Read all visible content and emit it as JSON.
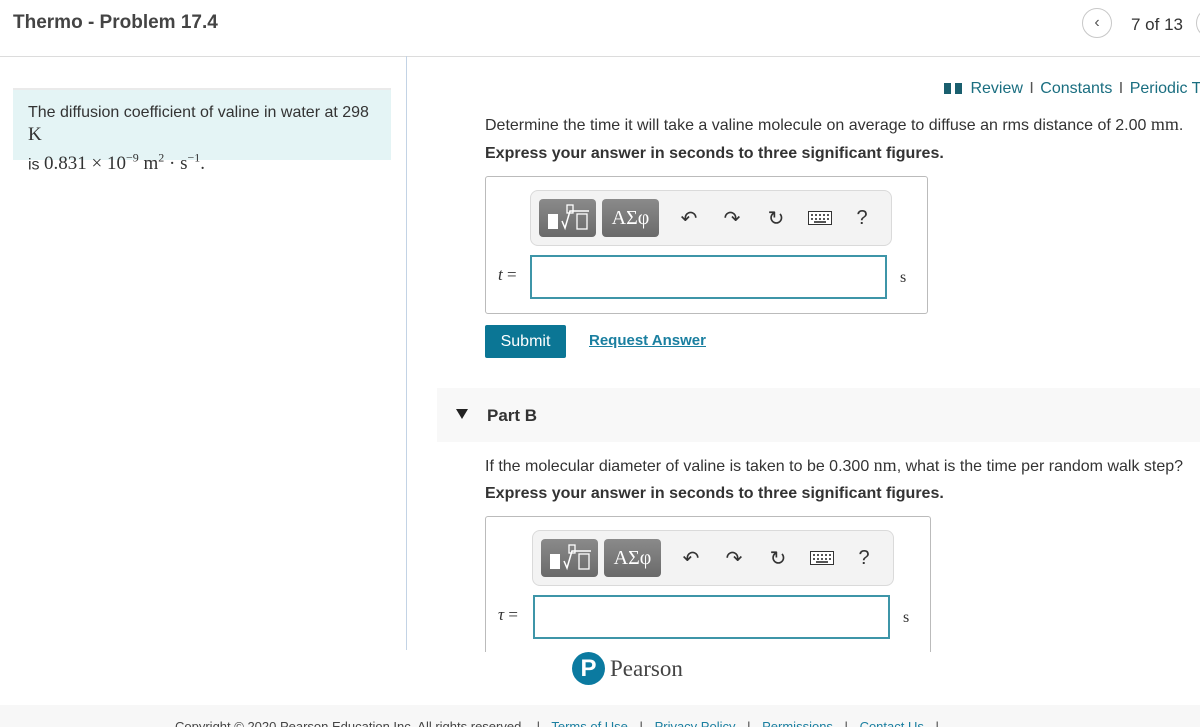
{
  "header": {
    "title": "Thermo - Problem 17.4",
    "nav": {
      "prev_icon": "chevron-left-icon",
      "position": "7 of 13",
      "next_icon": "chevron-right-icon"
    }
  },
  "intro": {
    "text": "The diffusion coefficient of valine in water at 298",
    "temp_unit": "K",
    "line2_prefix": "is ",
    "value": "0.831 × 10",
    "exponent": "−9",
    "unit_m": " m",
    "unit_m_exp": "2",
    "unit_dot_s": " · s",
    "unit_s_exp": "−1",
    "period": "."
  },
  "resources": {
    "icon": "book-icon",
    "links": [
      "Review",
      "Constants",
      "Periodic Table"
    ],
    "separator": "I"
  },
  "parts": [
    {
      "question_text": "Determine the time it will take a valine molecule on average to diffuse an rms distance of 2.00",
      "question_unit": "mm",
      "question_end": ".",
      "instruction": "Express your answer in seconds to three significant figures.",
      "variable": "t",
      "equals": "=",
      "input_value": "",
      "unit": "s",
      "toolbar": {
        "templates_icon": "templates-sqrt-icon",
        "symbols_label": "ΑΣφ",
        "undo_icon": "undo-icon",
        "redo_icon": "redo-icon",
        "reset_icon": "reset-icon",
        "keyboard_icon": "keyboard-icon",
        "help_label": "?"
      },
      "submit_label": "Submit",
      "request_label": "Request Answer"
    },
    {
      "title": "Part B",
      "expanded": true,
      "question_text": "If the molecular diameter of valine is taken to be 0.300",
      "question_unit": "nm",
      "question_end": ", what is the time per random walk step?",
      "instruction": "Express your answer in seconds to three significant figures.",
      "variable": "τ",
      "equals": "=",
      "input_value": "",
      "unit": "s",
      "toolbar": {
        "templates_icon": "templates-sqrt-icon",
        "symbols_label": "ΑΣφ",
        "undo_icon": "undo-icon",
        "redo_icon": "redo-icon",
        "reset_icon": "reset-icon",
        "keyboard_icon": "keyboard-icon",
        "help_label": "?"
      }
    }
  ],
  "brand": {
    "logo_letter": "P",
    "name": "Pearson",
    "color": "#0b7aa0"
  },
  "footer": {
    "copyright": "Copyright © 2020 Pearson Education Inc. All rights reserved.",
    "links": [
      "Terms of Use",
      "Privacy Policy",
      "Permissions",
      "Contact Us"
    ]
  },
  "colors": {
    "accent": "#0b7695",
    "link": "#1a7fa0",
    "intro_bg": "#e4f4f5",
    "input_border": "#3e95a8"
  }
}
